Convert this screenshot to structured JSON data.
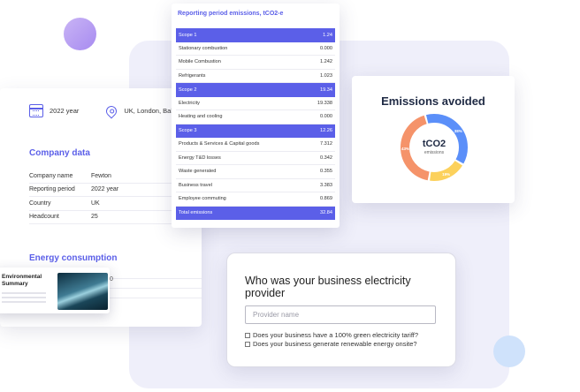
{
  "company": {
    "year": "2022 year",
    "location": "UK, London, Baker str.",
    "title": "Company data",
    "rows": [
      {
        "label": "Company name",
        "value": "Fewton"
      },
      {
        "label": "Reporting period",
        "value": "2022 year"
      },
      {
        "label": "Country",
        "value": "UK"
      },
      {
        "label": "Headcount",
        "value": "25"
      }
    ],
    "energy_title": "Energy consumption"
  },
  "env_summary": {
    "title": "Environmental Summary",
    "snippet": "0"
  },
  "emissions": {
    "header": "Reporting period emissions, tCO2-e",
    "rows": [
      {
        "label": "Scope 1",
        "value": "1.24",
        "kind": "scope"
      },
      {
        "label": "Stationary combustion",
        "value": "0.000",
        "kind": "item"
      },
      {
        "label": "Mobile Combustion",
        "value": "1.242",
        "kind": "item"
      },
      {
        "label": "Refrigerants",
        "value": "1.023",
        "kind": "item"
      },
      {
        "label": "Scope 2",
        "value": "19.34",
        "kind": "scope"
      },
      {
        "label": "Electricity",
        "value": "19.338",
        "kind": "item"
      },
      {
        "label": "Heating and cooling",
        "value": "0.000",
        "kind": "item"
      },
      {
        "label": "Scope 3",
        "value": "12.26",
        "kind": "scope"
      },
      {
        "label": "Products & Services & Capital goods",
        "value": "7.312",
        "kind": "item"
      },
      {
        "label": "Energy T&D losses",
        "value": "0.342",
        "kind": "item"
      },
      {
        "label": "Waste generated",
        "value": "0.355",
        "kind": "item"
      },
      {
        "label": "Business travel",
        "value": "3.383",
        "kind": "item"
      },
      {
        "label": "Employee commuting",
        "value": "0.869",
        "kind": "item"
      },
      {
        "label": "Total emissions",
        "value": "32.84",
        "kind": "total"
      }
    ]
  },
  "avoided": {
    "title": "Emissions avoided",
    "unit": "tCO2",
    "sub": "emissions",
    "segments": [
      {
        "label": "38%",
        "fraction": 0.38,
        "color": "#5b8ff9"
      },
      {
        "label": "19%",
        "fraction": 0.19,
        "color": "#fcd15c"
      },
      {
        "label": "43%",
        "fraction": 0.43,
        "color": "#f5936a"
      }
    ]
  },
  "question": {
    "title": "Who was your business electricity provider",
    "input_placeholder": "Provider name",
    "input_value": "",
    "options": [
      "Does your business have a 100% green electricity tariff?",
      "Does your business generate renewable energy onsite?"
    ]
  }
}
